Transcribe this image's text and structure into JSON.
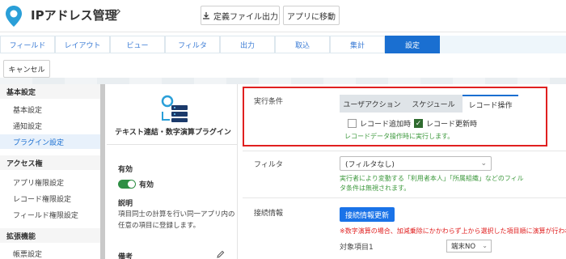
{
  "header": {
    "title": "IPアドレス管理",
    "export_button": "定義ファイル出力",
    "go_app_button": "アプリに移動"
  },
  "tabs": [
    {
      "label": "フィールド"
    },
    {
      "label": "レイアウト"
    },
    {
      "label": "ビュー"
    },
    {
      "label": "フィルタ"
    },
    {
      "label": "出力"
    },
    {
      "label": "取込"
    },
    {
      "label": "集計"
    },
    {
      "label": "設定",
      "active": true
    }
  ],
  "cancel_button": "キャンセル",
  "sidebar": {
    "sections": [
      {
        "title": "基本設定",
        "items": [
          "基本設定",
          "通知設定",
          "プラグイン設定"
        ]
      },
      {
        "title": "アクセス権",
        "items": [
          "アプリ権限設定",
          "レコード権限設定",
          "フィールド権限設定"
        ]
      },
      {
        "title": "拡張機能",
        "items": [
          "帳票設定"
        ]
      }
    ],
    "active_item": "プラグイン設定"
  },
  "plugin": {
    "name": "テキスト連結・数字演算プラグイン",
    "enabled_heading": "有効",
    "enabled_label": "有効",
    "description_heading": "説明",
    "description": "項目同士の計算を行い同一アプリ内の任意の項目に登録します。",
    "remark_heading": "備考"
  },
  "main": {
    "exec_condition_label": "実行条件",
    "subtabs": [
      "ユーザアクション",
      "スケジュール",
      "レコード操作"
    ],
    "active_subtab": "レコード操作",
    "checkbox_add": "レコード追加時",
    "checkbox_update": "レコード更新時",
    "checkbox_add_checked": false,
    "checkbox_update_checked": true,
    "exec_note": "レコードデータ操作時に実行します。",
    "filter_label": "フィルタ",
    "filter_value": "(フィルタなし)",
    "filter_note_1": "実行者により変動する「利用者本人」「所属組織」などのフィル",
    "filter_note_2": "タ条件は無視されます。",
    "connection_label": "接続情報",
    "connection_button": "接続情報更新",
    "connection_note": "※数字演算の場合、加減乗除にかかわらず上から選択した項目順に演算が行われます。",
    "target_label": "対象項目1",
    "target_value": "端末NO"
  },
  "colors": {
    "accent": "#1a6fd1",
    "highlight_border": "#e02020",
    "toggle_on": "#2f8f45",
    "note_green": "#3f9a3f",
    "note_red": "#e02020"
  }
}
